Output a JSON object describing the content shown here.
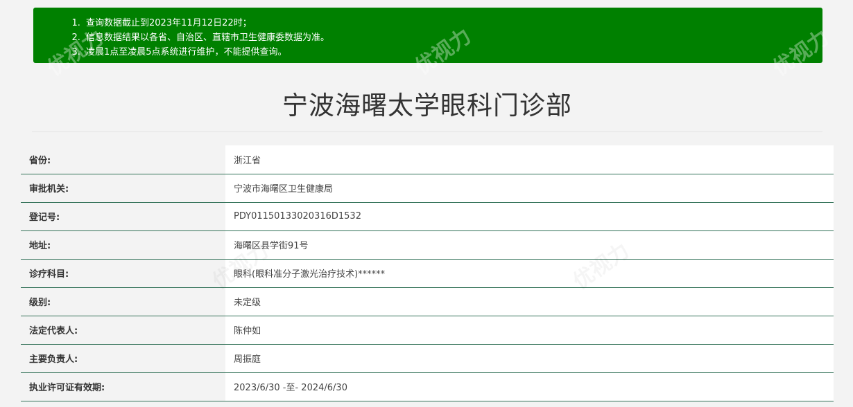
{
  "notice": {
    "items": [
      "查询数据截止到2023年11月12日22时；",
      "信息数据结果以各省、自治区、直辖市卫生健康委数据为准。",
      "凌晨1点至凌晨5点系统进行维护，不能提供查询。"
    ],
    "background_color": "#008000"
  },
  "page_title": "宁波海曙太学眼科门诊部",
  "watermark": "优视力",
  "rows": [
    {
      "label": "省份:",
      "value": "浙江省"
    },
    {
      "label": "审批机关:",
      "value": "宁波市海曙区卫生健康局"
    },
    {
      "label": "登记号:",
      "value": "PDY01150133020316D1532"
    },
    {
      "label": "地址:",
      "value": "海曙区县学街91号"
    },
    {
      "label": "诊疗科目:",
      "value": "眼科(眼科准分子激光治疗技术)******"
    },
    {
      "label": "级别:",
      "value": "未定级"
    },
    {
      "label": "法定代表人:",
      "value": "陈仲如"
    },
    {
      "label": "主要负责人:",
      "value": "周振庭"
    },
    {
      "label": "执业许可证有效期:",
      "value": "2023/6/30 -至- 2024/6/30"
    }
  ],
  "colors": {
    "table_border": "#2f6f55",
    "page_bg": "#f3f3f3"
  }
}
